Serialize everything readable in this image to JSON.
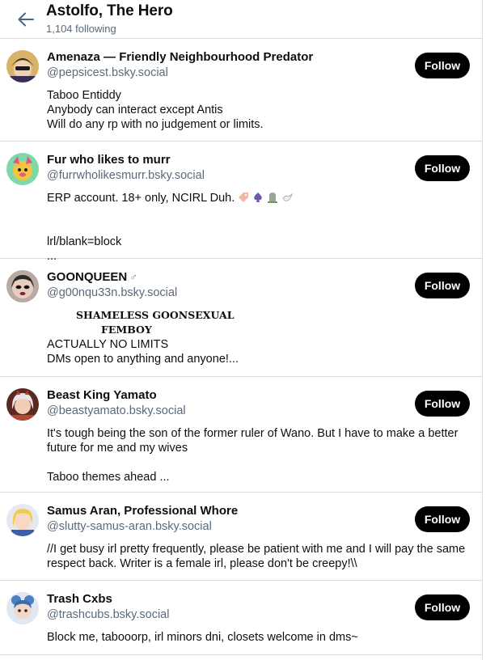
{
  "header": {
    "title": "Astolfo, The Hero",
    "subtitle": "1,104 following"
  },
  "follow_label": "Follow",
  "users": [
    {
      "name": "Amenaza — Friendly Neighbourhood Predator",
      "handle": "@pepsicest.bsky.social",
      "bio": "Taboo Entiddy\nAnybody can interact except Antis\nWill do any rp with no judgement or limits."
    },
    {
      "name": "Fur who likes to murr",
      "handle": "@furrwholikesmurr.bsky.social",
      "bio_text": "ERP account. 18+ only, NCIRL Duh.",
      "bio_rest": "lrl/blank=block\n..."
    },
    {
      "name": "GOONQUEEN",
      "name_symbol": "♂",
      "handle": "@g00nqu33n.bsky.social",
      "banner_line1": "SHAMELESS GOONSEXUAL",
      "banner_line2": "FEMBOY",
      "bio": "ACTUALLY NO LIMITS\nDMs open to anything and anyone!..."
    },
    {
      "name": "Beast King Yamato",
      "handle": "@beastyamato.bsky.social",
      "bio": "It's tough being the son of the former ruler of Wano. But I have to make a better future for me and my wives\n\nTaboo themes ahead ..."
    },
    {
      "name": "Samus Aran, Professional Whore",
      "handle": "@slutty-samus-aran.bsky.social",
      "bio": "//I get busy irl pretty frequently, please be patient with me and I will pay the same respect back. Writer is a female irl, please don't be creepy!\\\\"
    },
    {
      "name": "Trash Cxbs",
      "handle": "@trashcubs.bsky.social",
      "bio": "Block me, tabooorp, irl minors dni, closets welcome in dms~"
    }
  ]
}
